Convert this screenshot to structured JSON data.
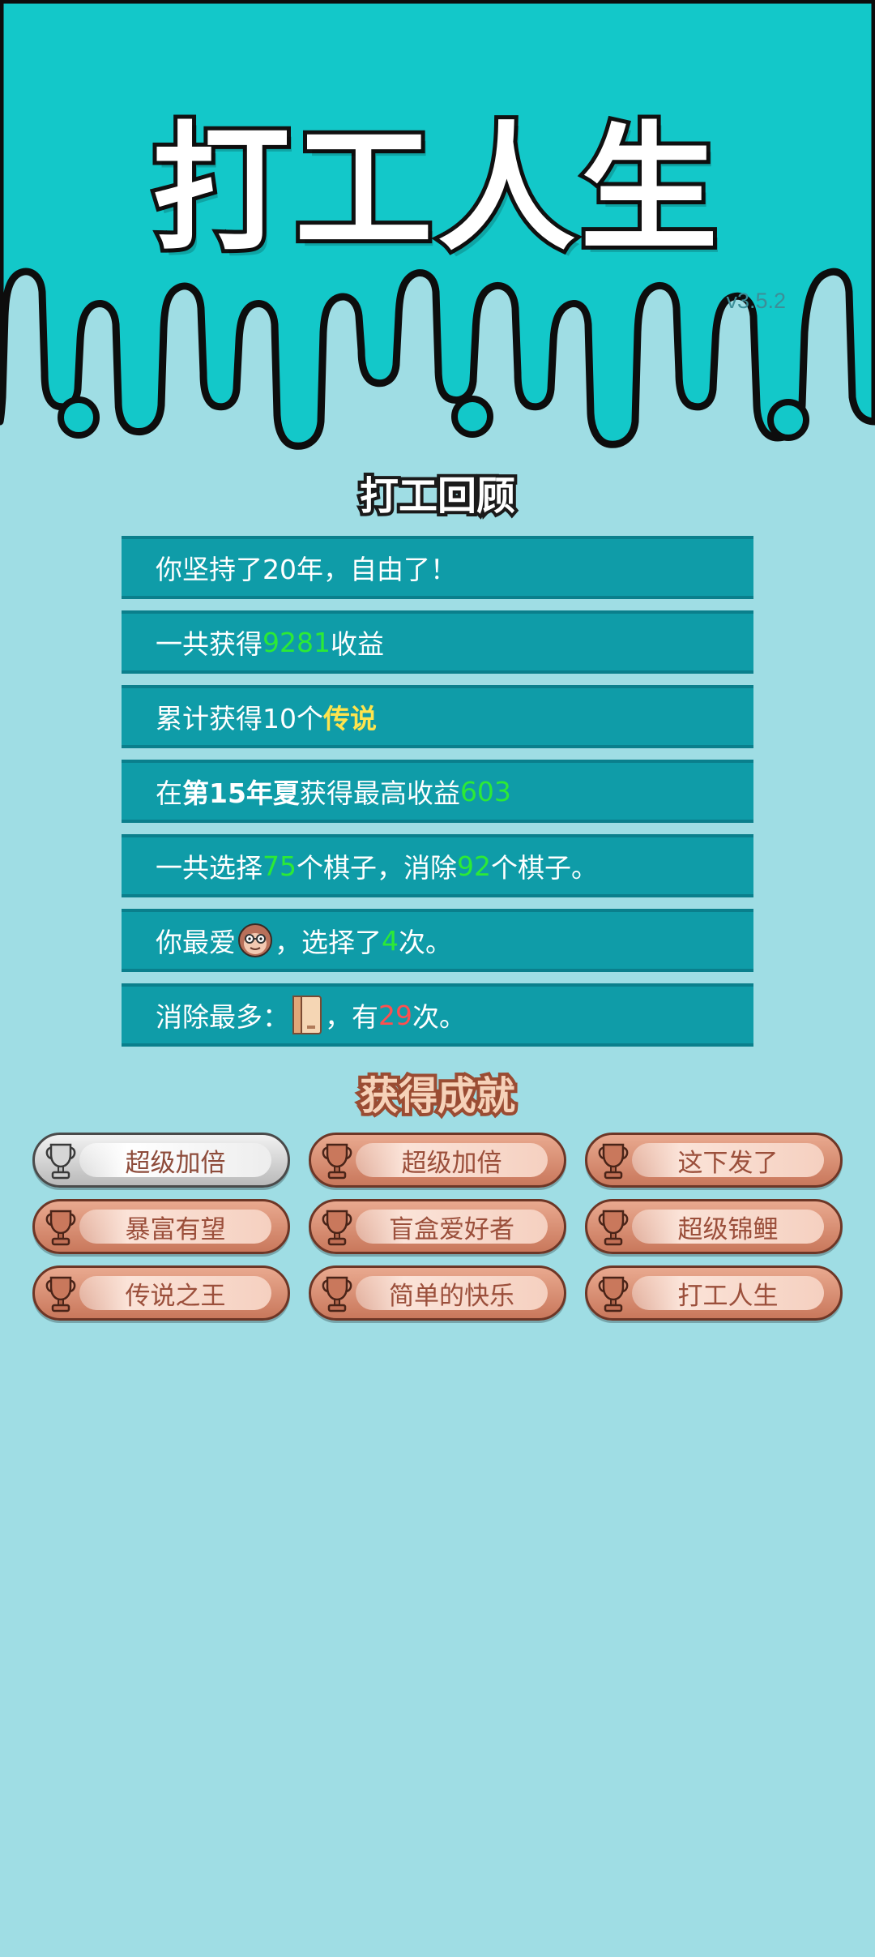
{
  "app": {
    "title": "打工人生",
    "version": "v3.5.2"
  },
  "review": {
    "title": "打工回顾",
    "rows": [
      {
        "text": "你坚持了20年，自由了！"
      },
      {
        "prefix": "一共获得",
        "value": "9281",
        "suffix": "收益"
      },
      {
        "prefix": "累计获得10个",
        "value": "传说"
      },
      {
        "prefix": "在 ",
        "bold": "第15年夏",
        "middle": " 获得最高收益",
        "value": "603"
      },
      {
        "prefix": "一共选择",
        "value": "75",
        "middle": "个棋子，消除",
        "value2": "92",
        "suffix": "个棋子。"
      },
      {
        "prefix": "你最爱",
        "icon": "monkey-face-icon",
        "middle": "，选择了",
        "value": "4",
        "suffix": "次。"
      },
      {
        "prefix": "消除最多：",
        "icon": "book-icon",
        "middle": "，有",
        "value": "29",
        "suffix": "次。"
      }
    ]
  },
  "achievements": {
    "title": "获得成就",
    "items": [
      {
        "label": "超级加倍",
        "tier": "silver"
      },
      {
        "label": "超级加倍",
        "tier": "bronze"
      },
      {
        "label": "这下发了",
        "tier": "bronze"
      },
      {
        "label": "暴富有望",
        "tier": "bronze"
      },
      {
        "label": "盲盒爱好者",
        "tier": "bronze"
      },
      {
        "label": "超级锦鲤",
        "tier": "bronze"
      },
      {
        "label": "传说之王",
        "tier": "bronze"
      },
      {
        "label": "简单的快乐",
        "tier": "bronze"
      },
      {
        "label": "打工人生",
        "tier": "bronze"
      }
    ]
  },
  "colors": {
    "header": "#13c8c9",
    "background": "#9fdde4",
    "row": "#0f9ca8",
    "highlight_green": "#2cea36",
    "highlight_yellow": "#ffe44d",
    "highlight_red": "#ff4f4f"
  }
}
